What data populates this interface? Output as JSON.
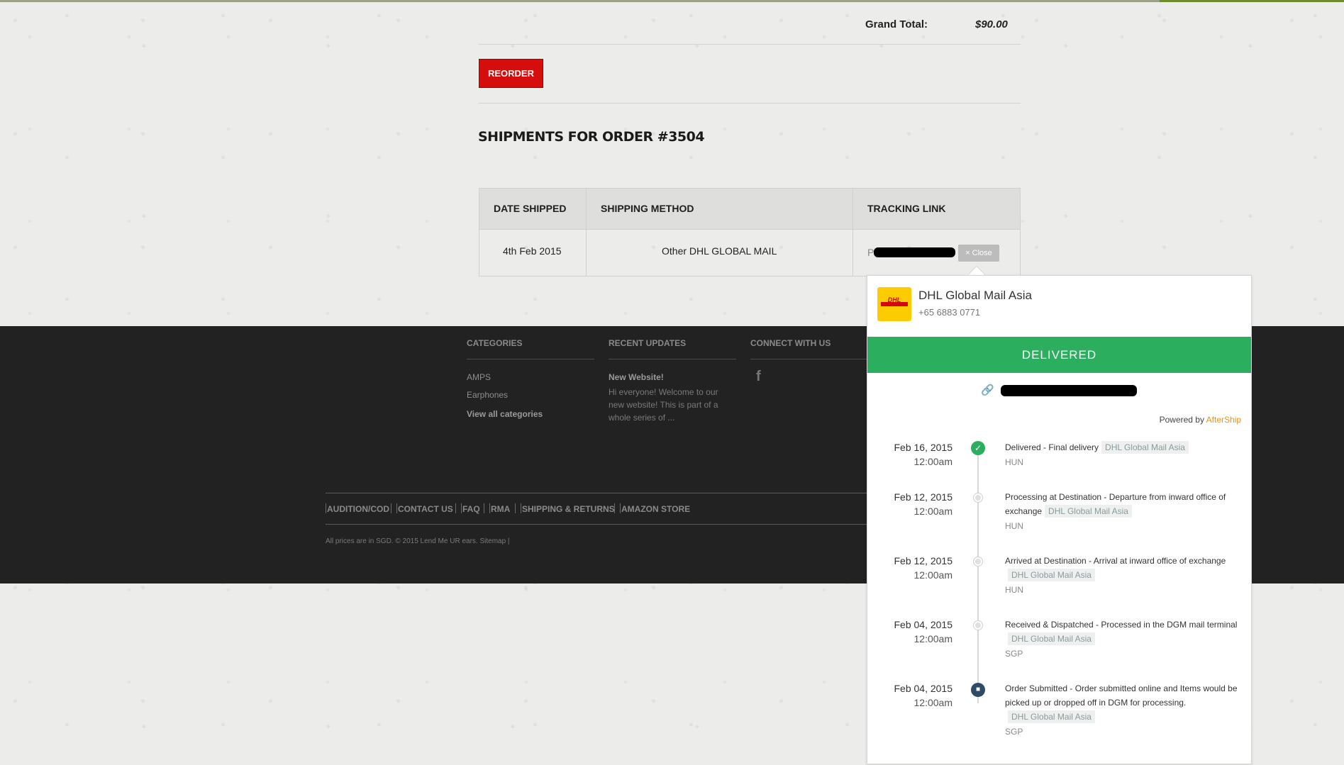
{
  "order": {
    "grand_total_label": "Grand Total:",
    "grand_total_value": "$90.00",
    "reorder_label": "REORDER",
    "shipments_title": "SHIPMENTS FOR ORDER #3504"
  },
  "shipments": {
    "headers": [
      "DATE SHIPPED",
      "SHIPPING METHOD",
      "TRACKING LINK"
    ],
    "rows": [
      {
        "date": "4th Feb 2015",
        "method": "Other DHL GLOBAL MAIL",
        "tracking_prefix": "P"
      }
    ],
    "close_label": "× Close"
  },
  "footer": {
    "categories": {
      "heading": "CATEGORIES",
      "items": [
        "AMPS",
        "Earphones"
      ],
      "view_all": "View all categories"
    },
    "recent_updates": {
      "heading": "RECENT UPDATES",
      "post_title": "New Website!",
      "post_excerpt": "Hi everyone! Welcome to our new website! This is part of a whole series of ..."
    },
    "connect": {
      "heading": "CONNECT WITH US",
      "facebook_glyph": "f"
    },
    "links": [
      "AUDITION/COD",
      "CONTACT US",
      "FAQ",
      "RMA",
      "SHIPPING & RETURNS",
      "AMAZON STORE"
    ],
    "copyright": "All prices are in SGD. © 2015 Lend Me UR ears. Sitemap |"
  },
  "tracking_popup": {
    "carrier_name": "DHL Global Mail Asia",
    "carrier_phone": "+65 6883 0771",
    "logo_text": "DHL",
    "status": "DELIVERED",
    "powered_by": "Powered by",
    "powered_brand": "AfterShip",
    "checkpoints": [
      {
        "date": "Feb 16, 2015",
        "time": "12:00am",
        "message": "Delivered - Final delivery",
        "carrier": "DHL Global Mail Asia",
        "location": "HUN"
      },
      {
        "date": "Feb 12, 2015",
        "time": "12:00am",
        "message": "Processing at Destination - Departure from inward office of exchange",
        "carrier": "DHL Global Mail Asia",
        "location": "HUN"
      },
      {
        "date": "Feb 12, 2015",
        "time": "12:00am",
        "message": "Arrived at Destination - Arrival at inward office of exchange",
        "carrier": "DHL Global Mail Asia",
        "location": "HUN"
      },
      {
        "date": "Feb 04, 2015",
        "time": "12:00am",
        "message": "Received & Dispatched - Processed in the DGM mail terminal",
        "carrier": "DHL Global Mail Asia",
        "location": "SGP"
      },
      {
        "date": "Feb 04, 2015",
        "time": "12:00am",
        "message": "Order Submitted - Order submitted online and Items would be picked up or dropped off in DGM for processing.",
        "carrier": "DHL Global Mail Asia",
        "location": "SGP"
      }
    ]
  },
  "colors": {
    "reorder_red": "#d50d0d",
    "delivered_green": "#2bae5e",
    "aftership_orange": "#e89418",
    "footer_bg": "#232223"
  }
}
